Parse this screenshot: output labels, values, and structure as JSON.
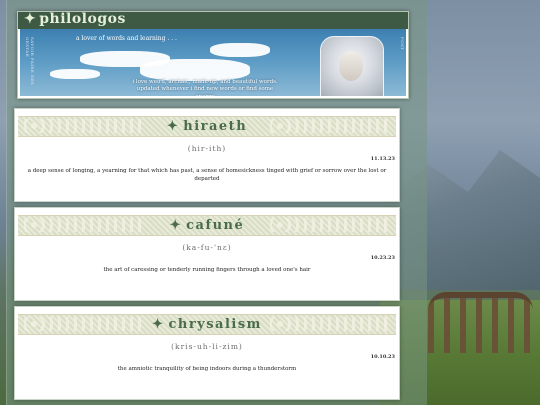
{
  "header": {
    "site_title": "philologos",
    "tagline": "a lover of words and learning . . .",
    "intro_text": "i love weird, archaic, made-up, and beautiful words. updated whenever i find new words or find some energy",
    "stamp_left": "SAVOIR FAIRE RES GESTAE",
    "stamp_right": "POST"
  },
  "posts": [
    {
      "word": "hiraeth",
      "pronunciation": "(hir-ith)",
      "date": "11.13.23",
      "definition": "a deep sense of longing, a yearning for that which has past, a sense of homesickness tinged with grief or sorrow over the lost or departed"
    },
    {
      "word": "cafuné",
      "pronunciation": "(ka-fu-'nε)",
      "date": "10.23.23",
      "definition": "the art of caressing or tenderly running fingers through a loved one's hair"
    },
    {
      "word": "chrysalism",
      "pronunciation": "(kris-uh-li-zim)",
      "date": "10.10.23",
      "definition": "the amniotic tranquility of being indoors during a thunderstorm"
    }
  ],
  "icons": {
    "sparkle": "✦"
  },
  "colors": {
    "accent_green": "#4a6b4e",
    "title_bar": "#3e5a44",
    "banner_sky": "#3d7fb0"
  }
}
